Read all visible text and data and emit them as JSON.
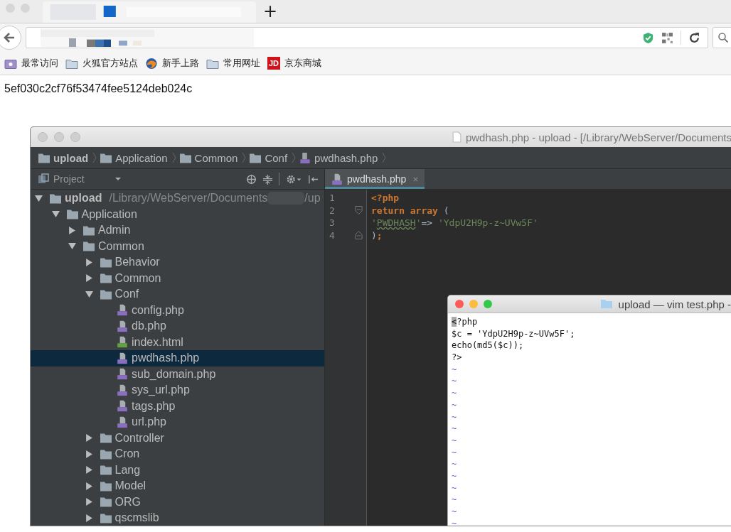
{
  "browser": {
    "new_tab_button": "+",
    "bookmarks": [
      {
        "label": "最常访问",
        "kind": "smart-folder"
      },
      {
        "label": "火狐官方站点",
        "kind": "folder"
      },
      {
        "label": "新手上路",
        "kind": "globe"
      },
      {
        "label": "常用网址",
        "kind": "folder"
      },
      {
        "label": "京东商城",
        "kind": "logo",
        "icon_text": "JD"
      }
    ]
  },
  "page": {
    "text": "5ef030c2cf76f53474fee5124deb024c"
  },
  "ide": {
    "title": "pwdhash.php - upload - [/Library/WebServer/Documents",
    "breadcrumbs": [
      {
        "label": "upload",
        "kind": "root"
      },
      {
        "label": "Application",
        "kind": "folder"
      },
      {
        "label": "Common",
        "kind": "folder"
      },
      {
        "label": "Conf",
        "kind": "folder"
      },
      {
        "label": "pwdhash.php",
        "kind": "php"
      }
    ],
    "project_panel": {
      "label": "Project"
    },
    "tree": [
      {
        "name": "upload",
        "kind": "root",
        "path": "/Library/WebServer/Documents",
        "path_end": "/up",
        "expanded": true,
        "selected": false,
        "children": [
          {
            "name": "Application",
            "kind": "folder",
            "expanded": true,
            "selected": false,
            "children": [
              {
                "name": "Admin",
                "kind": "folder",
                "expanded": false,
                "selected": false
              },
              {
                "name": "Common",
                "kind": "folder",
                "expanded": true,
                "selected": false,
                "children": [
                  {
                    "name": "Behavior",
                    "kind": "folder",
                    "expanded": false,
                    "selected": false
                  },
                  {
                    "name": "Common",
                    "kind": "folder",
                    "expanded": false,
                    "selected": false
                  },
                  {
                    "name": "Conf",
                    "kind": "folder",
                    "expanded": true,
                    "selected": false,
                    "children": [
                      {
                        "name": "config.php",
                        "kind": "php",
                        "selected": false
                      },
                      {
                        "name": "db.php",
                        "kind": "php",
                        "selected": false
                      },
                      {
                        "name": "index.html",
                        "kind": "html",
                        "selected": false
                      },
                      {
                        "name": "pwdhash.php",
                        "kind": "php",
                        "selected": true
                      },
                      {
                        "name": "sub_domain.php",
                        "kind": "php",
                        "selected": false
                      },
                      {
                        "name": "sys_url.php",
                        "kind": "php",
                        "selected": false
                      },
                      {
                        "name": "tags.php",
                        "kind": "php",
                        "selected": false
                      },
                      {
                        "name": "url.php",
                        "kind": "php",
                        "selected": false
                      }
                    ]
                  },
                  {
                    "name": "Controller",
                    "kind": "folder",
                    "expanded": false,
                    "selected": false
                  },
                  {
                    "name": "Cron",
                    "kind": "folder",
                    "expanded": false,
                    "selected": false
                  },
                  {
                    "name": "Lang",
                    "kind": "folder",
                    "expanded": false,
                    "selected": false
                  },
                  {
                    "name": "Model",
                    "kind": "folder",
                    "expanded": false,
                    "selected": false
                  },
                  {
                    "name": "ORG",
                    "kind": "folder",
                    "expanded": false,
                    "selected": false
                  },
                  {
                    "name": "qscmslib",
                    "kind": "folder",
                    "expanded": false,
                    "selected": false
                  }
                ]
              }
            ]
          }
        ]
      }
    ],
    "tabs": [
      {
        "label": "pwdhash.php",
        "selected": true
      }
    ],
    "editor": {
      "lines": [
        {
          "number": "1",
          "kind": "plain",
          "tokens": [
            {
              "text": "<?php",
              "kind": "keyword"
            }
          ]
        },
        {
          "number": "2",
          "kind": "fold-start",
          "tokens": [
            {
              "text": "return array",
              "kind": "keyword"
            },
            {
              "text": " (",
              "kind": "plain"
            }
          ]
        },
        {
          "number": "3",
          "kind": "plain",
          "tokens": [
            {
              "text": "'",
              "kind": "string"
            },
            {
              "text": "PWDHASH",
              "kind": "typo"
            },
            {
              "text": "'",
              "kind": "string"
            },
            {
              "text": "=> ",
              "kind": "plain"
            },
            {
              "text": "'YdpU2H9p-z~UVw5F'",
              "kind": "string"
            }
          ]
        },
        {
          "number": "4",
          "kind": "fold-end",
          "tokens": [
            {
              "text": ")",
              "kind": "plain"
            },
            {
              "text": ";",
              "kind": "keyword"
            }
          ]
        }
      ]
    }
  },
  "terminal": {
    "title": "upload — vim test.php -",
    "lines": [
      [
        {
          "text": "<",
          "kind": "cursor"
        },
        {
          "text": "?php",
          "kind": "text"
        }
      ],
      [
        {
          "text": "$c = 'YdpU2H9p-z~UVw5F';",
          "kind": "text"
        }
      ],
      [
        {
          "text": "echo(md5($c));",
          "kind": "text"
        }
      ],
      [
        {
          "text": "?>",
          "kind": "text"
        }
      ]
    ],
    "tildes": [
      "~",
      "~",
      "~",
      "~",
      "~",
      "~",
      "~",
      "~",
      "~",
      "~",
      "~",
      "~",
      "~",
      "~"
    ]
  }
}
